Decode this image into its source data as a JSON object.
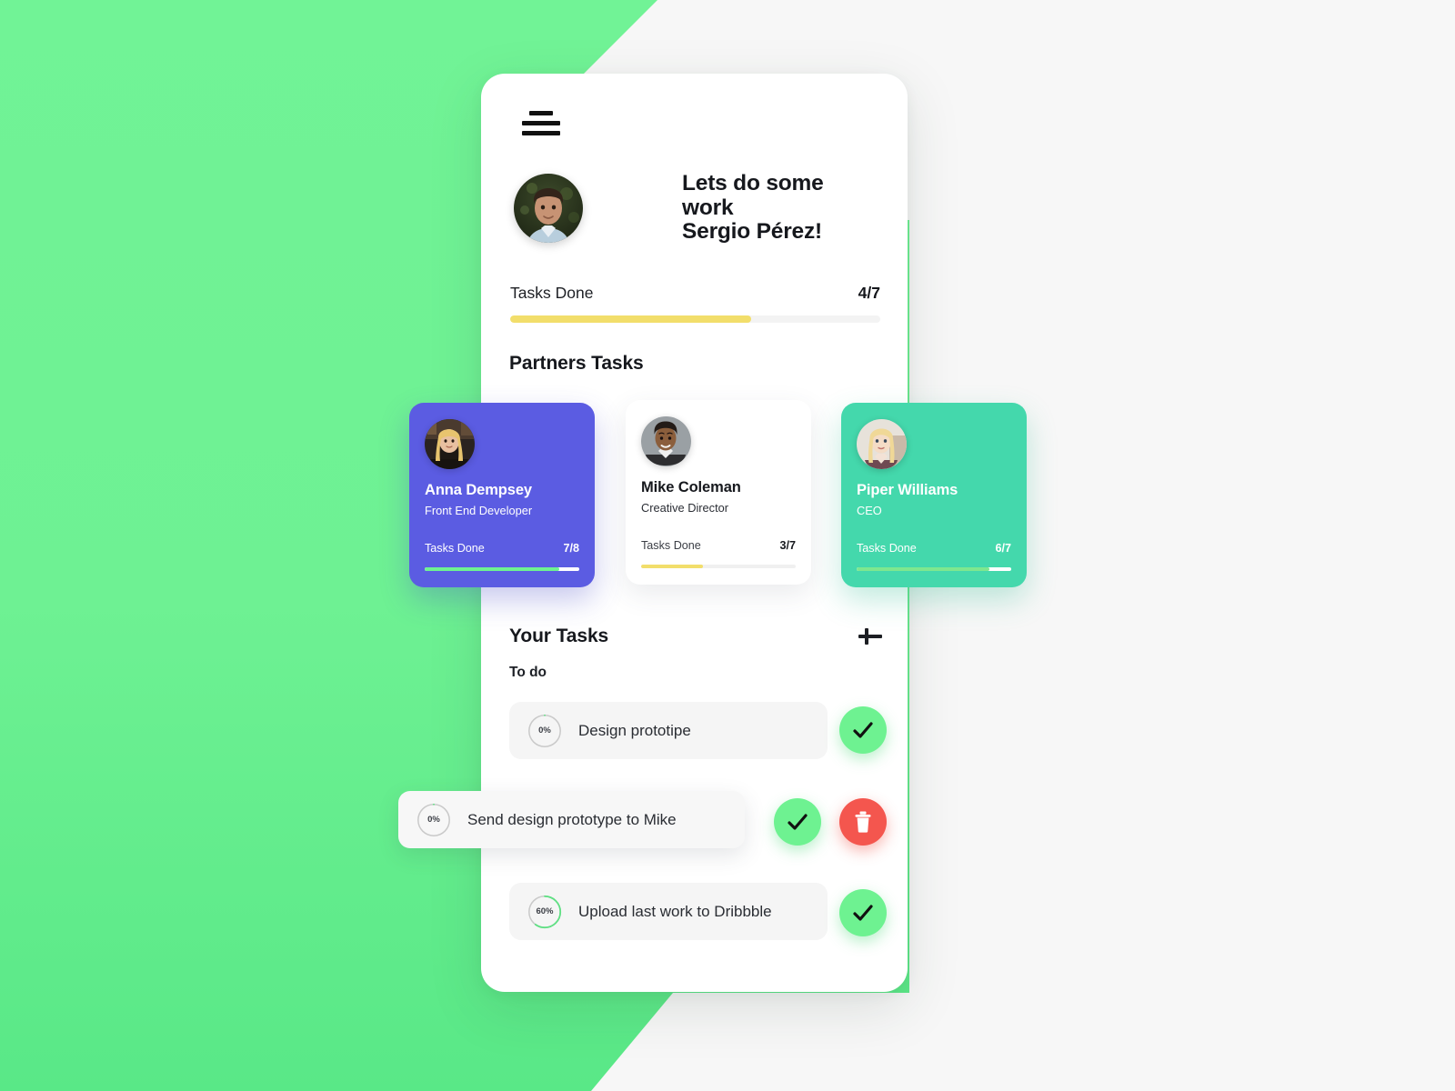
{
  "background": {
    "base_color": "#f7f7f7",
    "accent_color": "#6ff294",
    "shape_name": "green-angled-backdrop"
  },
  "phone": {
    "menu_icon": "hamburger-menu-icon",
    "header": {
      "avatar_name": "user-avatar",
      "greeting_line1": "Lets do some work",
      "greeting_line2": "Sergio Pérez!",
      "greeting_full": "Lets do some work\nSergio Pérez!"
    },
    "overall_progress": {
      "label": "Tasks Done",
      "value": "4/7",
      "done": 4,
      "total": 7,
      "percent": 65,
      "fill_color": "#f2de6b",
      "track_color": "#f3f3f3"
    },
    "partners_section": {
      "heading": "Partners Tasks",
      "cards": [
        {
          "name": "Anna Dempsey",
          "role": "Front End Developer",
          "stat_label": "Tasks Done",
          "stat_value": "7/8",
          "done": 7,
          "total": 8,
          "percent": 87,
          "card_color": "#5b5ce2",
          "fill_color": "#6ef291",
          "avatar_name": "partner-avatar-anna"
        },
        {
          "name": "Mike Coleman",
          "role": "Creative Director",
          "stat_label": "Tasks Done",
          "stat_value": "3/7",
          "done": 3,
          "total": 7,
          "percent": 40,
          "card_color": "#ffffff",
          "fill_color": "#f2de6b",
          "avatar_name": "partner-avatar-mike"
        },
        {
          "name": "Piper Williams",
          "role": "CEO",
          "stat_label": "Tasks Done",
          "stat_value": "6/7",
          "done": 6,
          "total": 7,
          "percent": 86,
          "card_color": "#44d8ac",
          "fill_color": "#7ee78f",
          "avatar_name": "partner-avatar-piper"
        }
      ]
    },
    "your_tasks_section": {
      "heading": "Your Tasks",
      "add_button_label": "+",
      "add_button_icon": "plus-icon",
      "group_label": "To do",
      "tasks": [
        {
          "title": "Design prototipe",
          "percent_label": "0%",
          "percent": 0,
          "swiped": false,
          "has_delete": false,
          "check_icon": "check-icon",
          "accent": "#6ef291"
        },
        {
          "title": "Send design prototype to Mike",
          "percent_label": "0%",
          "percent": 0,
          "swiped": true,
          "has_delete": true,
          "check_icon": "check-icon",
          "delete_icon": "trash-icon",
          "accent": "#6ef291",
          "delete_color": "#f4564e"
        },
        {
          "title": "Upload last work to Dribbble",
          "percent_label": "60%",
          "percent": 60,
          "swiped": false,
          "has_delete": false,
          "check_icon": "check-icon",
          "accent": "#6ef291"
        }
      ]
    }
  }
}
